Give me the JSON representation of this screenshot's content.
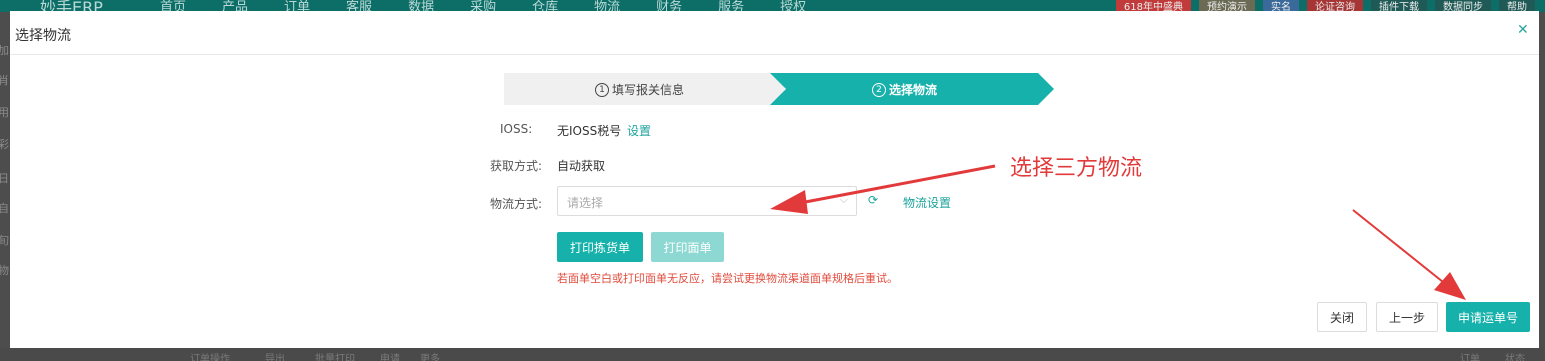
{
  "background": {
    "logo": "妙手ERP",
    "nav": [
      "首页",
      "产品",
      "订单",
      "客服",
      "数据",
      "采购",
      "仓库",
      "物流",
      "财务",
      "服务",
      "授权"
    ],
    "right": [
      "618年中盛典",
      "预约演示",
      "实名",
      "论证咨询",
      "插件下载",
      "数据同步",
      "帮助"
    ],
    "left_fragments": [
      "加",
      "肖",
      "用",
      "彩",
      "日",
      "自",
      "旬",
      "物"
    ],
    "bottom_fragments": [
      "订单操作",
      "导出",
      "批量打印",
      "申请",
      "更多",
      "订单",
      "状态"
    ]
  },
  "modal": {
    "title": "选择物流",
    "close_icon": "close-icon",
    "steps": [
      {
        "num": "1",
        "label": "填写报关信息",
        "active": false
      },
      {
        "num": "2",
        "label": "选择物流",
        "active": true
      }
    ],
    "ioss": {
      "label": "IOSS:",
      "value": "无IOSS税号",
      "link": "设置"
    },
    "fetch": {
      "label": "获取方式:",
      "value": "自动获取"
    },
    "logistics": {
      "label": "物流方式:",
      "placeholder": "请选择",
      "settings_link": "物流设置"
    },
    "buttons": {
      "print_pick": "打印拣货单",
      "print_label": "打印面单",
      "close": "关闭",
      "prev": "上一步",
      "apply": "申请运单号"
    },
    "warning": "若面单空白或打印面单无反应，请尝试更换物流渠道面单规格后重试。"
  },
  "annotation": {
    "text": "选择三方物流",
    "color": "#e23a3a"
  },
  "colors": {
    "accent": "#16b1aa",
    "step_active": "#16b1aa",
    "warning": "#e04b3d"
  }
}
